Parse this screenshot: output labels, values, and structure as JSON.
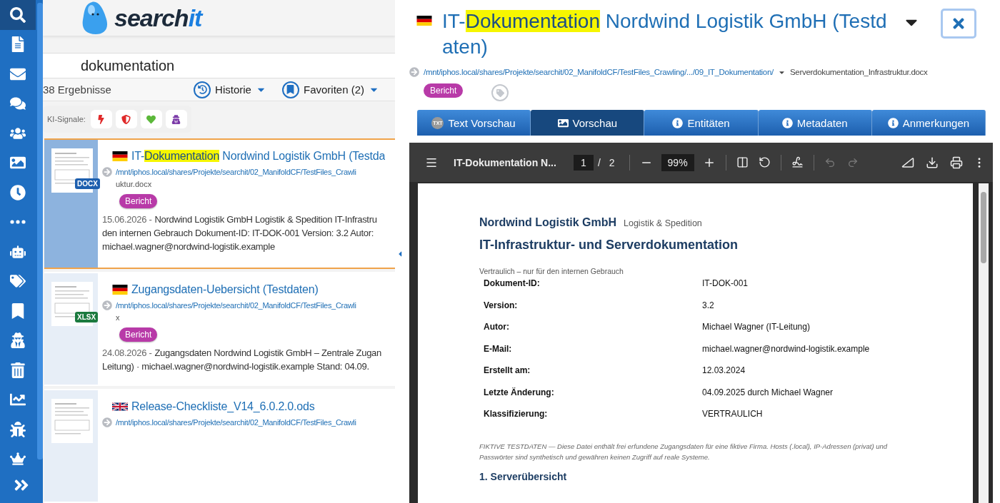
{
  "sidebar": {
    "items": [
      {
        "selected": true
      },
      {
        "selected": false
      },
      {
        "selected": false
      },
      {
        "selected": false
      },
      {
        "selected": false
      },
      {
        "selected": false
      },
      {
        "selected": false
      },
      {
        "selected": false
      },
      {
        "selected": false
      },
      {
        "selected": false
      },
      {
        "selected": false
      },
      {
        "selected": false
      },
      {
        "selected": false
      },
      {
        "selected": false
      },
      {
        "selected": false
      },
      {
        "selected": false
      }
    ]
  },
  "logo": {
    "text": "search",
    "accent": "it"
  },
  "search": {
    "value": "dokumentation"
  },
  "results_count": "38 Ergebnisse",
  "history": {
    "label": "Historie"
  },
  "favorites": {
    "label": "Favoriten (2)"
  },
  "ki_signals": {
    "label": "KI-Signale:",
    "buttons": [
      {
        "kind": "bolt"
      },
      {
        "kind": "shield"
      },
      {
        "kind": "heart"
      },
      {
        "kind": "spy"
      }
    ]
  },
  "results": [
    {
      "selected": true,
      "file_type": "DOCX",
      "flag": {
        "kind": "german"
      },
      "title": [
        {
          "text": "IT-",
          "highlight": false
        },
        {
          "text": "Dokumentation",
          "highlight": true
        },
        {
          "text": " Nordwind Logistik GmbH (Testda",
          "highlight": false
        }
      ],
      "path": "/mnt/iphos.local/shares/Projekte/searchit/02_ManifoldCF/TestFiles_Crawli",
      "path_tail": "uktur.docx",
      "badge": "Bericht",
      "date": "15.06.2026 -",
      "snippet_lines": [
        "Nordwind Logistik GmbH Logistik & Spedition IT-Infrastru",
        "den internen Gebrauch Dokument-ID: IT-DOK-001 Version: 3.2 Autor:",
        "michael.wagner@nordwind-logistik.example"
      ]
    },
    {
      "selected": false,
      "file_type": "XLSX",
      "flag": {
        "kind": "german"
      },
      "title": [
        {
          "text": "Zugangsdaten-Uebersicht (Testdaten)",
          "highlight": false
        }
      ],
      "path": "/mnt/iphos.local/shares/Projekte/searchit/02_ManifoldCF/TestFiles_Crawli",
      "path_tail": "x",
      "badge": "Bericht",
      "date": "24.08.2026 -",
      "snippet_lines": [
        "Zugangsdaten Nordwind Logistik GmbH – Zentrale Zugan",
        "Leitung) · michael.wagner@nordwind-logistik.example Stand: 04.09."
      ]
    },
    {
      "selected": false,
      "flag": {
        "kind": "british"
      },
      "title": [
        {
          "text": "Release-Checkliste_V14_6.0.2.0.ods",
          "highlight": false
        }
      ],
      "path": "/mnt/iphos.local/shares/Projekte/searchit/02_ManifoldCF/TestFiles_Crawli"
    }
  ],
  "detail": {
    "flag": {
      "kind": "german"
    },
    "title": [
      {
        "text": "IT-",
        "highlight": false
      },
      {
        "text": "Dokumentation",
        "highlight": true
      },
      {
        "text": " Nordwind Logistik GmbH (Testdaten)",
        "highlight": false
      }
    ],
    "path": "/mnt/iphos.local/shares/Projekte/searchit/02_ManifoldCF/TestFiles_Crawling/.../09_IT_Dokumentation/",
    "file_name": "Serverdokumentation_Infrastruktur.docx",
    "badge": "Bericht",
    "tabs": [
      {
        "label": "Text Vorschau",
        "kind": "txt",
        "icon_text": "TXT",
        "selected": false
      },
      {
        "label": "Vorschau",
        "kind": "image",
        "selected": true
      },
      {
        "label": "Entitäten",
        "kind": "info",
        "selected": false
      },
      {
        "label": "Metadaten",
        "kind": "info",
        "selected": false
      },
      {
        "label": "Anmerkungen",
        "kind": "info",
        "selected": false
      }
    ],
    "viewer": {
      "doc_title": "IT-Dokumentation N...",
      "page": "1",
      "page_sep": "/",
      "page_total": "2",
      "zoom": "99%",
      "undo_disabled": true,
      "redo_disabled": true
    },
    "document": {
      "company": "Nordwind Logistik GmbH",
      "tagline": "Logistik & Spedition",
      "heading": "IT-Infrastruktur- und Serverdokumentation",
      "confidentiality": "Vertraulich – nur für den internen Gebrauch",
      "fields": [
        {
          "label": "Dokument-ID:",
          "value": "IT-DOK-001"
        },
        {
          "label": "Version:",
          "value": "3.2"
        },
        {
          "label": "Autor:",
          "value": "Michael Wagner (IT-Leitung)"
        },
        {
          "label": "E-Mail:",
          "value": "michael.wagner@nordwind-logistik.example"
        },
        {
          "label": "Erstellt am:",
          "value": "12.03.2024"
        },
        {
          "label": "Letzte Änderung:",
          "value": "04.09.2025 durch Michael Wagner"
        },
        {
          "label": "Klassifizierung:",
          "value": "VERTRAULICH"
        }
      ],
      "disclaimer": "FIKTIVE TESTDATEN — Diese Datei enthält frei erfundene Zugangsdaten für eine fiktive Firma. Hosts (.local), IP-Adressen (privat) und Passwörter sind synthetisch und gewähren keinen Zugriff auf reale Systeme.",
      "section_heading": "1. Serverübersicht"
    }
  }
}
